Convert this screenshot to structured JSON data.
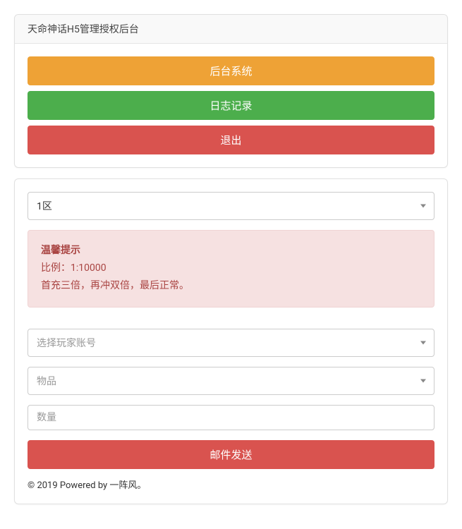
{
  "header": {
    "title": "天命神话H5管理授权后台"
  },
  "nav": {
    "system_label": "后台系统",
    "log_label": "日志记录",
    "logout_label": "退出"
  },
  "form": {
    "zone_selected": "1区",
    "alert": {
      "title": "温馨提示",
      "line1": "比例：1:10000",
      "line2": "首充三倍，再冲双倍，最后正常。"
    },
    "player_placeholder": "选择玩家账号",
    "item_placeholder": "物品",
    "quantity_placeholder": "数量",
    "send_label": "邮件发送"
  },
  "footer": {
    "text": "© 2019 Powered by 一阵风。"
  }
}
